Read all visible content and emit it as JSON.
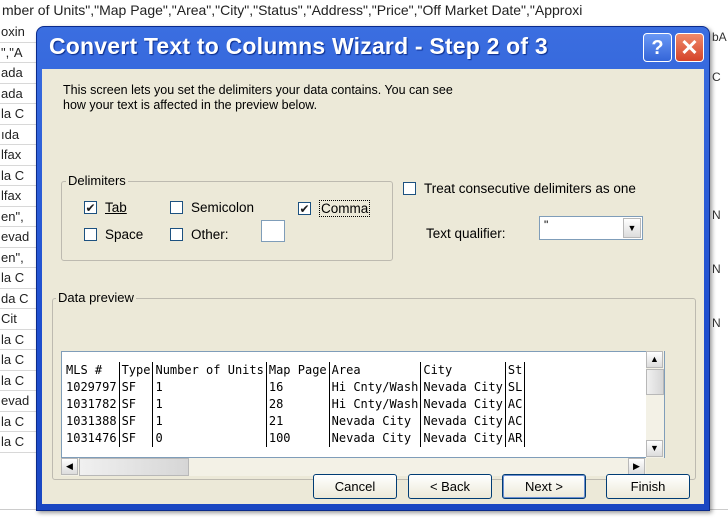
{
  "background": {
    "top_row": "mber of Units\",\"Map Page\",\"Area\",\"City\",\"Status\",\"Address\",\"Price\",\"Off Market Date\",\"Approxi",
    "col_cells": [
      "oxin",
      "\",\"A",
      "ada",
      "ada",
      "la C",
      "ıda",
      "lfax",
      "la C",
      "lfax",
      "en\",",
      "evad",
      "en\",",
      "la C",
      "da C",
      "Cit",
      "la C",
      "la C",
      "la C",
      "evad",
      "la C",
      "la C"
    ],
    "right_cells": [
      "bA",
      "C",
      "N",
      "N",
      "N"
    ]
  },
  "window": {
    "title": "Convert Text to Columns Wizard - Step 2 of 3",
    "help_label": "?",
    "close_label": "✕"
  },
  "intro": {
    "line1": "This screen lets you set the delimiters your data contains.  You can see",
    "line2": "how your text is affected in the preview below."
  },
  "delimiters": {
    "legend": "Delimiters",
    "tab": {
      "label": "Tab",
      "checked": true
    },
    "semicolon": {
      "label": "Semicolon",
      "checked": false
    },
    "comma": {
      "label": "Comma",
      "checked": true
    },
    "space": {
      "label": "Space",
      "checked": false
    },
    "other": {
      "label": "Other:",
      "checked": false,
      "value": ""
    }
  },
  "consecutive": {
    "label": "Treat consecutive delimiters as one",
    "checked": false
  },
  "qualifier": {
    "label": "Text qualifier:",
    "value": "\""
  },
  "preview": {
    "legend": "Data preview",
    "headers": [
      "MLS #",
      "Type",
      "Number of Units",
      "Map Page",
      "Area",
      "City",
      "St"
    ],
    "rows": [
      [
        "1029797",
        "SF",
        "1",
        "16",
        "Hi Cnty/Wash",
        "Nevada City",
        "SL"
      ],
      [
        "1031782",
        "SF",
        "1",
        "28",
        "Hi Cnty/Wash",
        "Nevada City",
        "AC"
      ],
      [
        "1031388",
        "SF",
        "1",
        "21",
        "Nevada City",
        "Nevada City",
        "AC"
      ],
      [
        "1031476",
        "SF",
        "0",
        "100",
        "Nevada City",
        "Nevada City",
        "AR"
      ]
    ]
  },
  "buttons": {
    "cancel": "Cancel",
    "back": "< Back",
    "next": "Next >",
    "finish": "Finish"
  }
}
